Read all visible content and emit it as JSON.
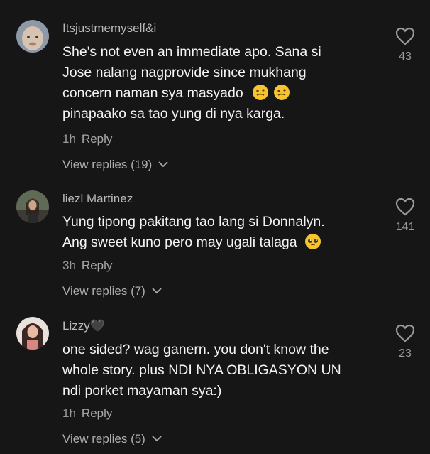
{
  "comments": [
    {
      "username": "Itsjustmemyself&i",
      "lines": [
        "She's not even an immediate apo. Sana si",
        "Jose nalang nagprovide since mukhang",
        "concern naman sya masyado",
        "pinapaako sa tao yung di nya karga."
      ],
      "time": "1h",
      "reply_label": "Reply",
      "view_replies": "View replies (19)",
      "likes": "43"
    },
    {
      "username": "liezl Martinez",
      "lines": [
        "Yung tipong pakitang tao lang si Donnalyn.",
        "Ang sweet kuno pero may ugali talaga"
      ],
      "time": "3h",
      "reply_label": "Reply",
      "view_replies": "View replies (7)",
      "likes": "141"
    },
    {
      "username": "Lizzy🖤",
      "lines": [
        "one sided? wag ganern. you don't know the",
        "whole story. plus NDI NYA OBLIGASYON UN",
        "ndi porket mayaman sya:)"
      ],
      "time": "1h",
      "reply_label": "Reply",
      "view_replies": "View replies (5)",
      "likes": "23"
    }
  ],
  "icons": {
    "like": "heart-outline-icon",
    "expand": "chevron-down-icon"
  },
  "colors": {
    "background": "#161616",
    "text": "#f4f4f4",
    "muted": "#9a9a9a",
    "emoji": "#f7c42e"
  }
}
